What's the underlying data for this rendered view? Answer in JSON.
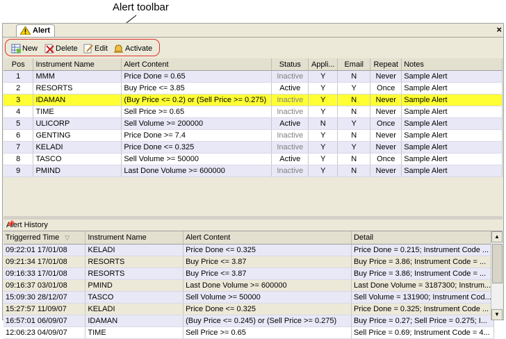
{
  "annotation": {
    "label": "Alert toolbar"
  },
  "tab": {
    "label": "Alert",
    "close": "×"
  },
  "toolbar": {
    "new": "New",
    "delete": "Delete",
    "edit": "Edit",
    "activate": "Activate"
  },
  "alerts": {
    "columns": [
      "Pos",
      "Instrument Name",
      "Alert Content",
      "Status",
      "Appli...",
      "Email",
      "Repeat",
      "Notes"
    ],
    "rows": [
      {
        "pos": "1",
        "name": "MMM",
        "content": "Price Done = 0.65",
        "status": "Inactive",
        "appli": "Y",
        "email": "N",
        "repeat": "Never",
        "notes": "Sample Alert"
      },
      {
        "pos": "2",
        "name": "RESORTS",
        "content": "Buy Price <= 3.85",
        "status": "Active",
        "appli": "Y",
        "email": "Y",
        "repeat": "Once",
        "notes": "Sample Alert"
      },
      {
        "pos": "3",
        "name": "IDAMAN",
        "content": "(Buy Price <= 0.2) or (Sell Price >= 0.275)",
        "status": "Inactive",
        "appli": "Y",
        "email": "N",
        "repeat": "Never",
        "notes": "Sample Alert"
      },
      {
        "pos": "4",
        "name": "TIME",
        "content": "Sell Price >= 0.65",
        "status": "Inactive",
        "appli": "Y",
        "email": "N",
        "repeat": "Never",
        "notes": "Sample Alert"
      },
      {
        "pos": "5",
        "name": "ULICORP",
        "content": "Sell Volume >= 200000",
        "status": "Active",
        "appli": "N",
        "email": "Y",
        "repeat": "Once",
        "notes": "Sample Alert"
      },
      {
        "pos": "6",
        "name": "GENTING",
        "content": "Price Done >= 7.4",
        "status": "Inactive",
        "appli": "Y",
        "email": "N",
        "repeat": "Never",
        "notes": "Sample Alert"
      },
      {
        "pos": "7",
        "name": "KELADI",
        "content": "Price Done <= 0.325",
        "status": "Inactive",
        "appli": "Y",
        "email": "Y",
        "repeat": "Never",
        "notes": "Sample Alert"
      },
      {
        "pos": "8",
        "name": "TASCO",
        "content": "Sell Volume >= 50000",
        "status": "Active",
        "appli": "Y",
        "email": "N",
        "repeat": "Once",
        "notes": "Sample Alert"
      },
      {
        "pos": "9",
        "name": "PMIND",
        "content": "Last Done Volume >= 600000",
        "status": "Inactive",
        "appli": "Y",
        "email": "N",
        "repeat": "Never",
        "notes": "Sample Alert"
      }
    ]
  },
  "history": {
    "title": "Alert History",
    "pin": "📌",
    "columns": [
      "Triggerred Time",
      "Instrument Name",
      "Alert Content",
      "Detail"
    ],
    "rows": [
      {
        "time": "09:22:01 17/01/08",
        "name": "KELADI",
        "content": "Price Done <= 0.325",
        "detail": "Price Done = 0.215; Instrument Code ..."
      },
      {
        "time": "09:21:34 17/01/08",
        "name": "RESORTS",
        "content": "Buy Price <= 3.87",
        "detail": "Buy Price = 3.86; Instrument Code = ..."
      },
      {
        "time": "09:16:33 17/01/08",
        "name": "RESORTS",
        "content": "Buy Price <= 3.87",
        "detail": "Buy Price = 3.86; Instrument Code = ..."
      },
      {
        "time": "09:16:37 03/01/08",
        "name": "PMIND",
        "content": "Last Done Volume >= 600000",
        "detail": "Last Done Volume = 3187300; Instrum..."
      },
      {
        "time": "15:09:30 28/12/07",
        "name": "TASCO",
        "content": "Sell Volume >= 50000",
        "detail": "Sell Volume = 131900; Instrument Cod..."
      },
      {
        "time": "15:27:57 11/09/07",
        "name": "KELADI",
        "content": "Price Done <= 0.325",
        "detail": "Price Done = 0.325; Instrument Code ..."
      },
      {
        "time": "16:57:01 06/09/07",
        "name": "IDAMAN",
        "content": "(Buy Price <= 0.245) or (Sell Price >= 0.275)",
        "detail": "Buy Price = 0.27; Sell Price = 0.275; I..."
      },
      {
        "time": "12:06:23 04/09/07",
        "name": "TIME",
        "content": "Sell Price >= 0.65",
        "detail": "Sell Price = 0.69; Instrument Code = 4..."
      }
    ]
  },
  "colors": {
    "selected_row": "#ffff33",
    "alt_row": "#e8e8f7",
    "highlight_ring": "#e03030"
  }
}
